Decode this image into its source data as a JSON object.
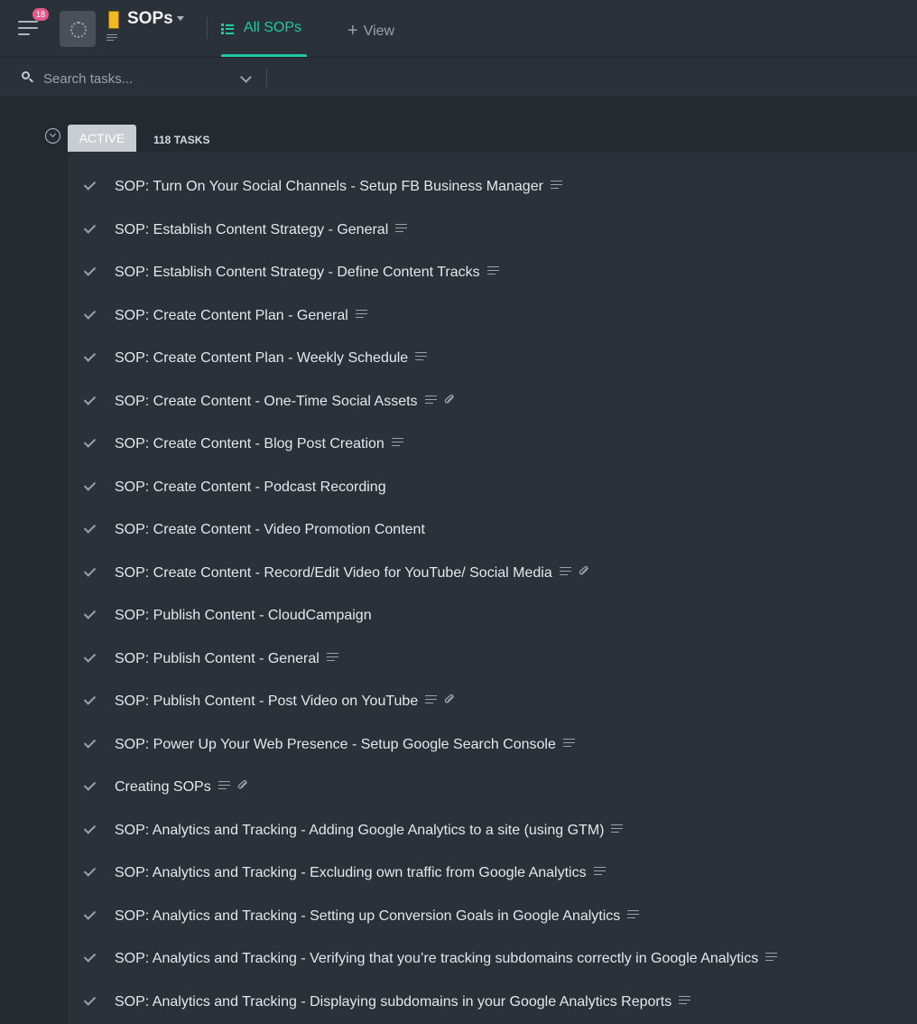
{
  "header": {
    "notification_count": "18",
    "space_title": "SOPs",
    "tab_all": "All SOPs",
    "add_view": "View"
  },
  "search": {
    "placeholder": "Search tasks..."
  },
  "group": {
    "status": "ACTIVE",
    "count_label": "118 TASKS"
  },
  "tasks": [
    {
      "name": "SOP: Turn On Your Social Channels - Setup FB Business Manager",
      "has_description": true,
      "has_attachment": false
    },
    {
      "name": "SOP: Establish Content Strategy - General",
      "has_description": true,
      "has_attachment": false
    },
    {
      "name": "SOP: Establish Content Strategy - Define Content Tracks",
      "has_description": true,
      "has_attachment": false
    },
    {
      "name": "SOP: Create Content Plan - General",
      "has_description": true,
      "has_attachment": false
    },
    {
      "name": "SOP: Create Content Plan - Weekly Schedule",
      "has_description": true,
      "has_attachment": false
    },
    {
      "name": "SOP: Create Content - One-Time Social Assets",
      "has_description": true,
      "has_attachment": true
    },
    {
      "name": "SOP: Create Content - Blog Post Creation",
      "has_description": true,
      "has_attachment": false
    },
    {
      "name": "SOP: Create Content - Podcast Recording",
      "has_description": false,
      "has_attachment": false
    },
    {
      "name": "SOP: Create Content - Video Promotion Content",
      "has_description": false,
      "has_attachment": false
    },
    {
      "name": "SOP: Create Content - Record/Edit Video for YouTube/ Social Media",
      "has_description": true,
      "has_attachment": true
    },
    {
      "name": "SOP: Publish Content - CloudCampaign",
      "has_description": false,
      "has_attachment": false
    },
    {
      "name": "SOP: Publish Content - General",
      "has_description": true,
      "has_attachment": false
    },
    {
      "name": "SOP: Publish Content - Post Video on YouTube",
      "has_description": true,
      "has_attachment": true
    },
    {
      "name": "SOP: Power Up Your Web Presence - Setup Google Search Console",
      "has_description": true,
      "has_attachment": false
    },
    {
      "name": "Creating SOPs",
      "has_description": true,
      "has_attachment": true
    },
    {
      "name": "SOP: Analytics and Tracking - Adding Google Analytics to a site (using GTM)",
      "has_description": true,
      "has_attachment": false
    },
    {
      "name": "SOP: Analytics and Tracking - Excluding own traffic from Google Analytics",
      "has_description": true,
      "has_attachment": false
    },
    {
      "name": "SOP: Analytics and Tracking - Setting up Conversion Goals in Google Analytics",
      "has_description": true,
      "has_attachment": false
    },
    {
      "name": "SOP: Analytics and Tracking - Verifying that you’re tracking subdomains correctly in Google Analytics",
      "has_description": true,
      "has_attachment": false
    },
    {
      "name": "SOP: Analytics and Tracking - Displaying subdomains in your Google Analytics Reports",
      "has_description": true,
      "has_attachment": false
    }
  ],
  "colors": {
    "accent": "#1fc7a4",
    "badge": "#e8578c",
    "folder": "#f2b822",
    "status_active": "#c9cdd1"
  }
}
